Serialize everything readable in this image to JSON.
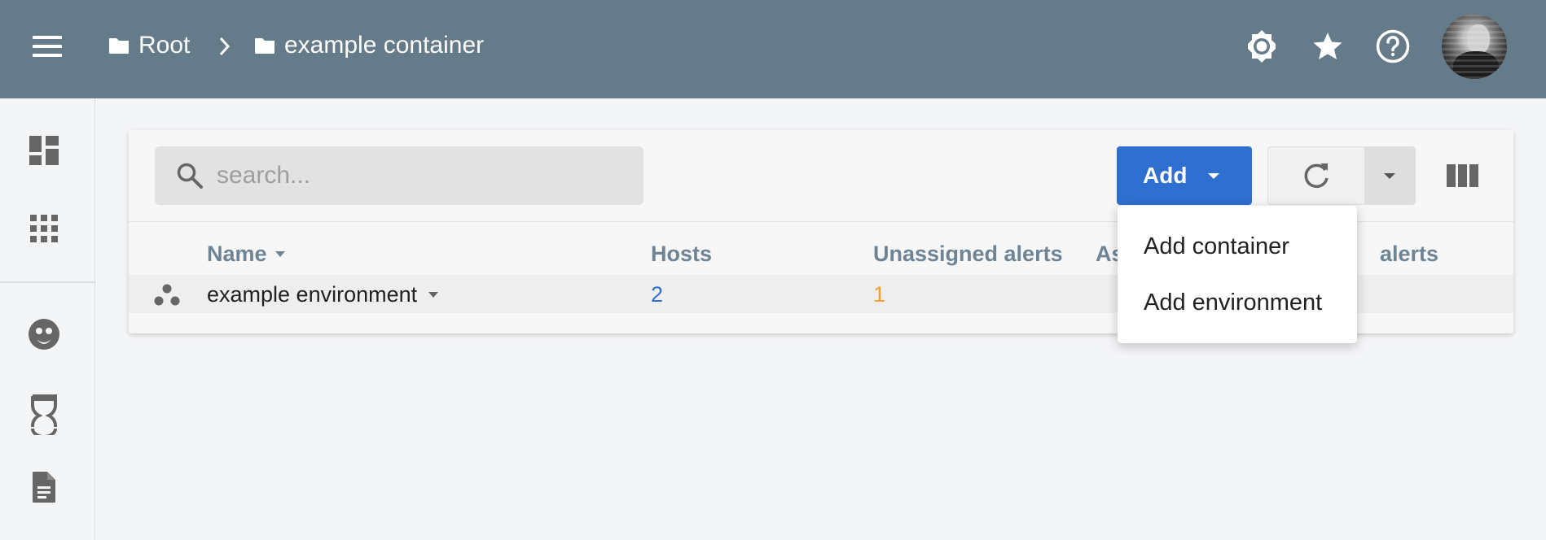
{
  "header": {
    "breadcrumb": [
      {
        "label": "Root"
      },
      {
        "label": "example container"
      }
    ],
    "icons": [
      "menu-icon",
      "brightness-icon",
      "star-icon",
      "help-icon"
    ]
  },
  "sidebar": {
    "items": [
      "dashboard-icon",
      "apps-grid-icon",
      "face-icon",
      "bot-icon",
      "document-icon"
    ]
  },
  "toolbar": {
    "search_placeholder": "search...",
    "add_label": "Add",
    "accent_color": "#2f6fd0"
  },
  "table": {
    "columns": [
      "Name",
      "Hosts",
      "Unassigned alerts",
      "As",
      "alerts"
    ],
    "rows": [
      {
        "name": "example environment",
        "hosts": "2",
        "unassigned_alerts": "1"
      }
    ],
    "colors": {
      "hosts": "#2f6fd0",
      "unassigned_alerts": "#f0a030"
    }
  },
  "menu": {
    "items": [
      "Add container",
      "Add environment"
    ]
  }
}
